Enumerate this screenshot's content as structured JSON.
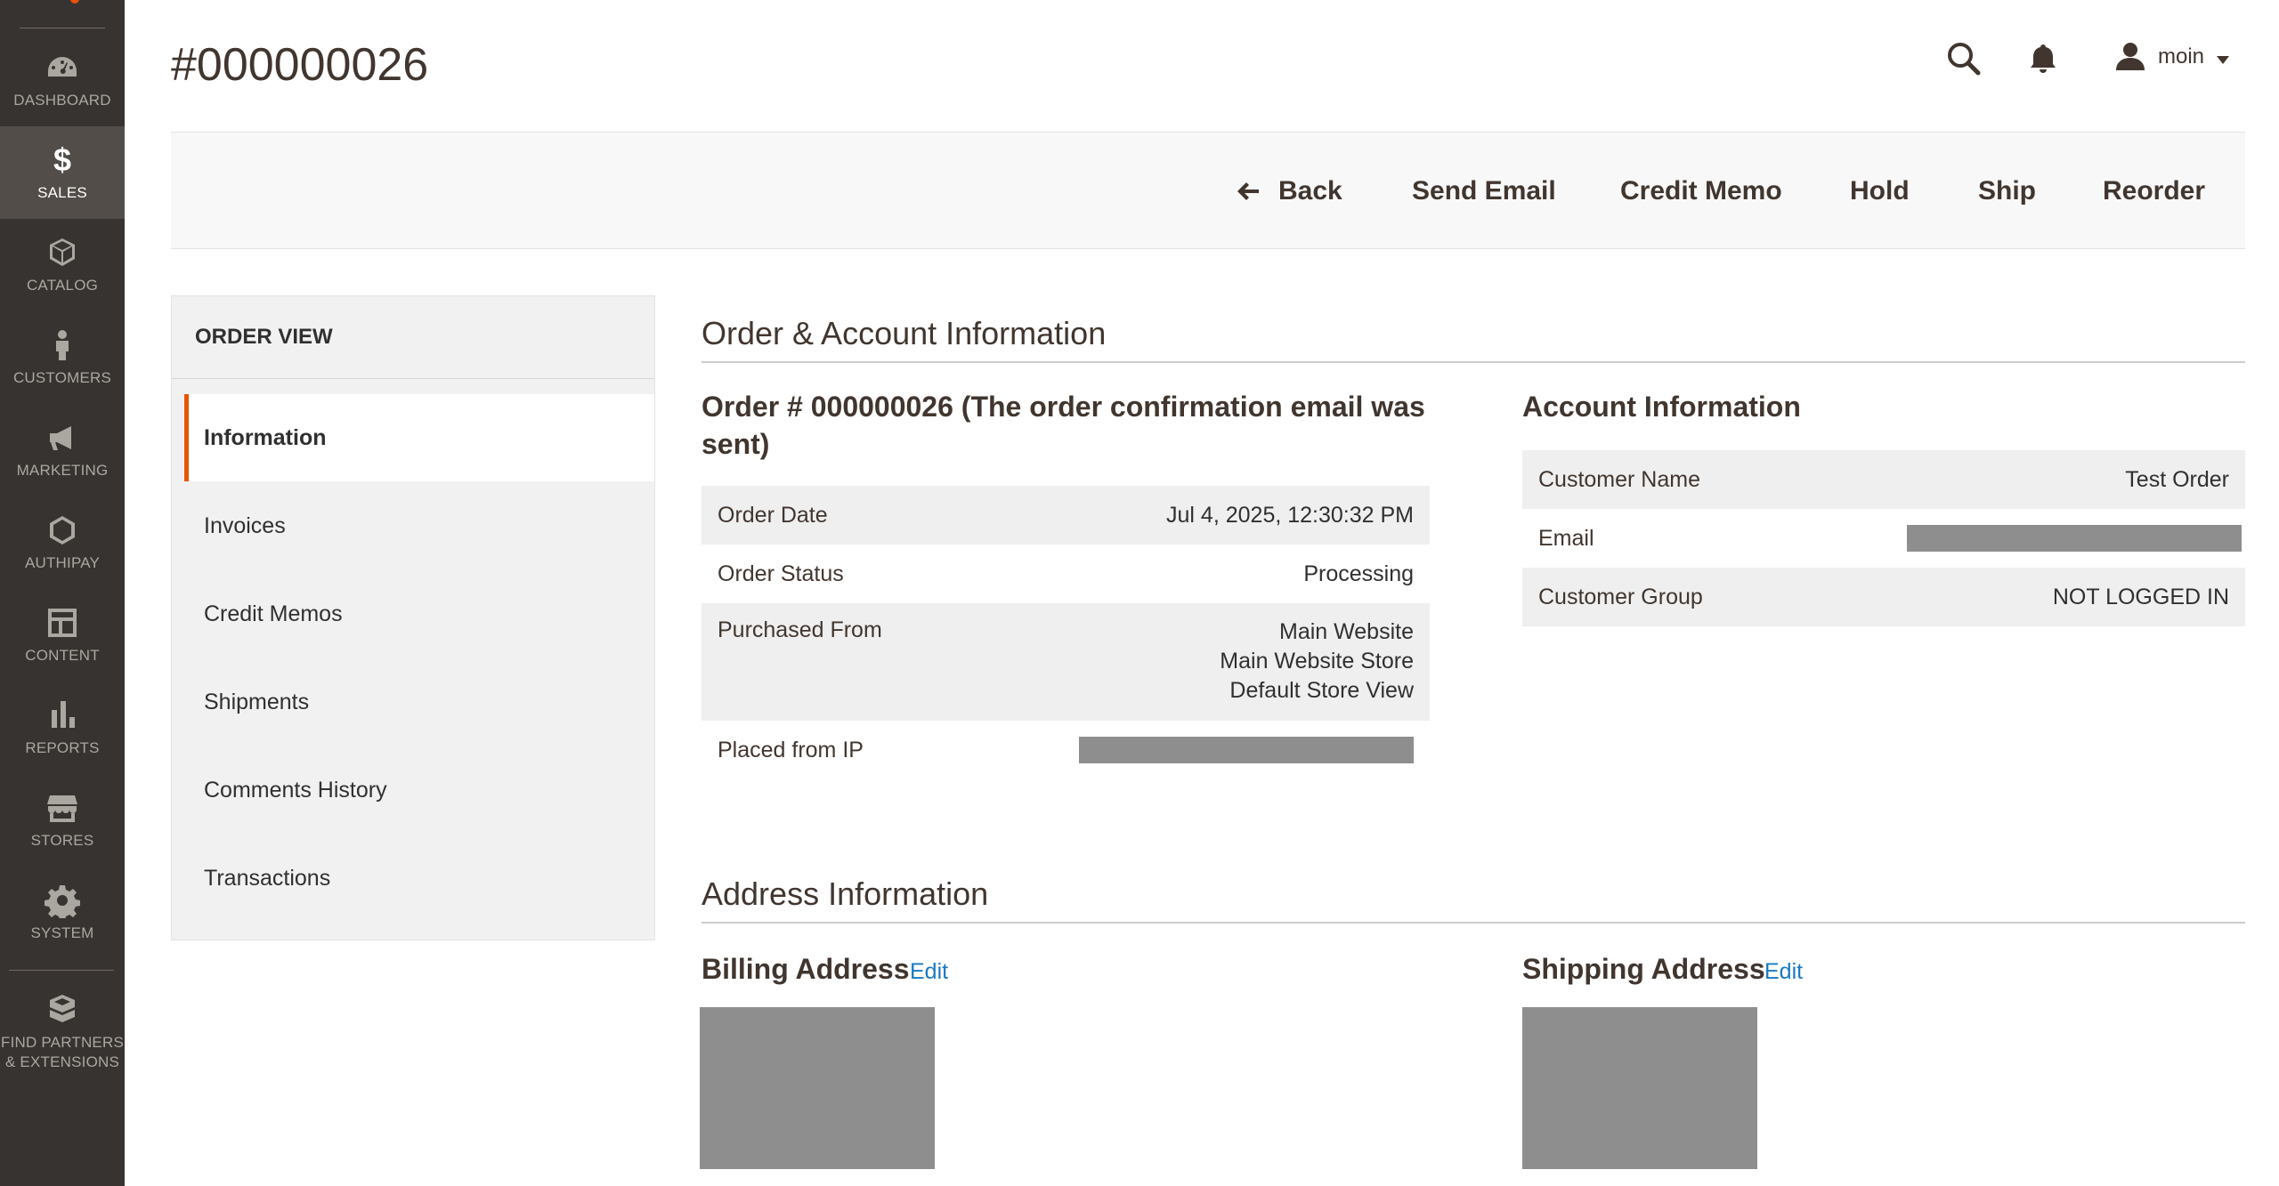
{
  "sidebar": {
    "items": [
      {
        "label": "DASHBOARD",
        "icon": "dashboard-icon",
        "active": false
      },
      {
        "label": "SALES",
        "icon": "dollar-icon",
        "active": true
      },
      {
        "label": "CATALOG",
        "icon": "cube-icon",
        "active": false
      },
      {
        "label": "CUSTOMERS",
        "icon": "person-icon",
        "active": false
      },
      {
        "label": "MARKETING",
        "icon": "megaphone-icon",
        "active": false
      },
      {
        "label": "AUTHIPAY",
        "icon": "hexagon-icon",
        "active": false
      },
      {
        "label": "CONTENT",
        "icon": "layout-icon",
        "active": false
      },
      {
        "label": "REPORTS",
        "icon": "bar-chart-icon",
        "active": false
      },
      {
        "label": "STORES",
        "icon": "storefront-icon",
        "active": false
      },
      {
        "label": "SYSTEM",
        "icon": "gear-icon",
        "active": false
      },
      {
        "label": "FIND PARTNERS & EXTENSIONS",
        "icon": "boxes-icon",
        "active": false
      }
    ],
    "accent_color": "#eb5202",
    "background_color": "#373330"
  },
  "header": {
    "title": "#000000026",
    "user": "moin"
  },
  "actions": {
    "back": "Back",
    "send_email": "Send Email",
    "credit_memo": "Credit Memo",
    "hold": "Hold",
    "ship": "Ship",
    "reorder": "Reorder"
  },
  "order_view": {
    "title": "ORDER VIEW",
    "tabs": [
      "Information",
      "Invoices",
      "Credit Memos",
      "Shipments",
      "Comments History",
      "Transactions"
    ],
    "active_tab": "Information"
  },
  "order_account": {
    "section_title": "Order & Account Information",
    "order": {
      "title": "Order # 000000026 (The order confirmation email was sent)",
      "rows": {
        "order_date": {
          "label": "Order Date",
          "value": "Jul 4, 2025, 12:30:32 PM"
        },
        "order_status": {
          "label": "Order Status",
          "value": "Processing"
        },
        "purchased_from": {
          "label": "Purchased From",
          "lines": [
            "Main Website",
            "Main Website Store",
            "Default Store View"
          ]
        },
        "placed_from_ip": {
          "label": "Placed from IP"
        }
      }
    },
    "account": {
      "title": "Account Information",
      "rows": {
        "customer_name": {
          "label": "Customer Name",
          "value": "Test Order"
        },
        "email": {
          "label": "Email"
        },
        "customer_group": {
          "label": "Customer Group",
          "value": "NOT LOGGED IN"
        }
      }
    }
  },
  "address": {
    "section_title": "Address Information",
    "billing": {
      "title": "Billing Address",
      "edit": "Edit"
    },
    "shipping": {
      "title": "Shipping Address",
      "edit": "Edit"
    }
  }
}
